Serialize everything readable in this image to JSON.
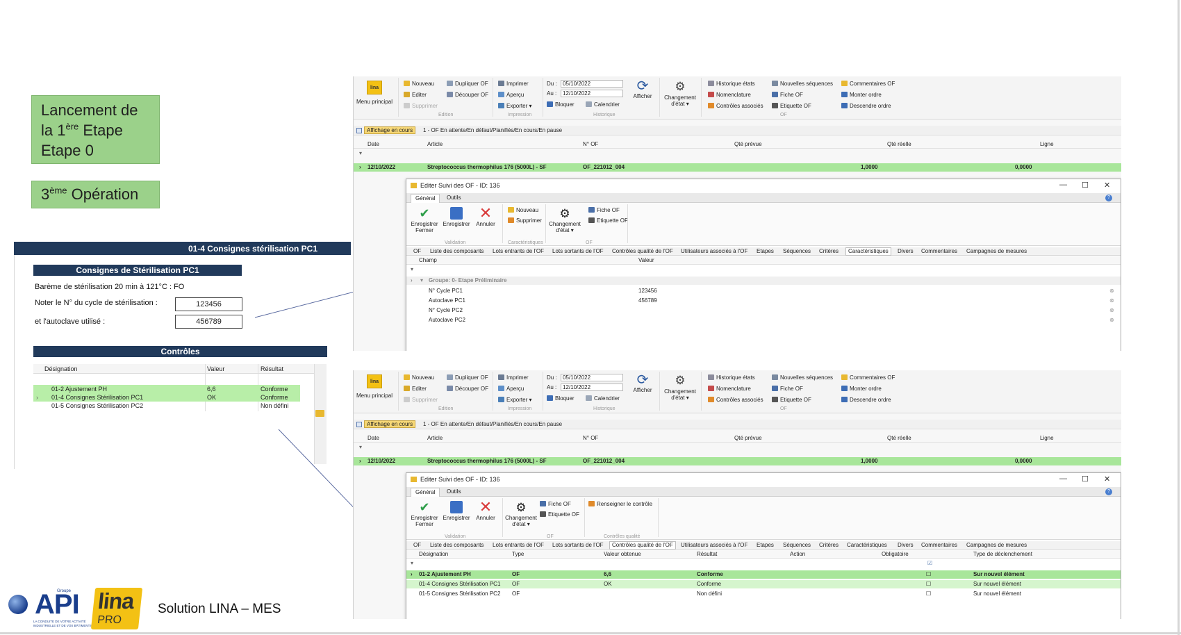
{
  "slide": {
    "title_box": {
      "line1": "Lancement de",
      "line2_pre": "la 1",
      "line2_sup": "ère",
      "line2_post": " Etape",
      "line3": "Etape 0"
    },
    "op_box": {
      "pre": "3",
      "sup": "ème",
      "post": " Opération"
    },
    "footer": "Solution LINA – MES",
    "logo_api": "API",
    "logo_api_small": "Groupe",
    "logo_api_tagline1": "LA CONDUITE DE VOTRE ACTIVITÉ",
    "logo_api_tagline2": "INDUSTRIELLE ET DE VOS BÂTIMENTS",
    "logo_lina": "lina",
    "logo_pro": "PRO"
  },
  "form": {
    "panel_title": "01-4 Consignes stérilisation PC1",
    "section_title": "Consignes de Stérilisation PC1",
    "bareme": "Barème de stérilisation 20 min à 121°C : FO",
    "cycle_label": "Noter le N° du cycle de stérilisation :",
    "cycle_value": "123456",
    "autoclave_label": "et l'autoclave utilisé :",
    "autoclave_value": "456789",
    "controls_title": "Contrôles",
    "table_headers": [
      "Désignation",
      "Valeur",
      "Résultat"
    ],
    "rows": [
      {
        "designation": "01-2 Ajustement PH",
        "valeur": "6,6",
        "resultat": "Conforme"
      },
      {
        "designation": "01-4 Consignes Stérilisation PC1",
        "valeur": "OK",
        "resultat": "Conforme"
      },
      {
        "designation": "01-5 Consignes Stérilisation PC2",
        "valeur": "",
        "resultat": "Non défini"
      }
    ]
  },
  "ribbon": {
    "menu_principal": "Menu principal",
    "nouveau": "Nouveau",
    "editer": "Editer",
    "supprimer": "Supprimer",
    "dupliquer": "Dupliquer OF",
    "decouper": "Découper OF",
    "imprimer": "Imprimer",
    "apercu": "Aperçu",
    "exporter": "Exporter",
    "du_label": "Du :",
    "du_value": "05/10/2022",
    "au_label": "Au :",
    "au_value": "12/10/2022",
    "bloquer": "Bloquer",
    "calendrier": "Calendrier",
    "afficher": "Afficher",
    "changement": "Changement",
    "detat": "d'état",
    "historique_etats": "Historique états",
    "nomenclature": "Nomenclature",
    "controles_associes": "Contrôles associés",
    "nouvelles_sequences": "Nouvelles séquences",
    "fiche_of": "Fiche OF",
    "etiquette_of": "Etiquette OF",
    "commentaires_of": "Commentaires OF",
    "monter_ordre": "Monter ordre",
    "descendre_ordre": "Descendre ordre",
    "groups": [
      "Edition",
      "Impression",
      "Historique",
      "OF"
    ]
  },
  "filter": {
    "tag": "Affichage en cours",
    "text": "1 - OF En attente/En défaut/Planifiés/En cours/En pause"
  },
  "grid": {
    "headers": [
      "Date",
      "Article",
      "N° OF",
      "Qté prévue",
      "Qté réelle",
      "Ligne"
    ],
    "row": {
      "date": "12/10/2022",
      "article": "Streptococcus thermophilus 176 (5000L) - SF",
      "of": "OF_221012_004",
      "qte_prevue": "1,0000",
      "qte_reelle": "0,0000"
    }
  },
  "dialog": {
    "title": "Editer Suivi des OF - ID: 136",
    "tabs": [
      "Général",
      "Outils"
    ],
    "enregistrer_fermer_1": "Enregistrer",
    "enregistrer_fermer_2": "Fermer",
    "enregistrer": "Enregistrer",
    "annuler": "Annuler",
    "nouveau": "Nouveau",
    "supprimer": "Supprimer",
    "changement": "Changement",
    "detat": "d'état",
    "fiche_of": "Fiche OF",
    "etiquette_of": "Etiquette OF",
    "renseigner": "Renseigner le contrôle",
    "groups_top": [
      "Validation",
      "Caractéristiques",
      "OF"
    ],
    "groups_bottom": [
      "Validation",
      "OF",
      "Contrôles qualité"
    ],
    "subtabs": [
      "OF",
      "Liste des composants",
      "Lots entrants de l'OF",
      "Lots sortants de l'OF",
      "Contrôles qualité de l'OF",
      "Utilisateurs associés à l'OF",
      "Etapes",
      "Séquences",
      "Critères",
      "Caractéristiques",
      "Divers",
      "Commentaires",
      "Campagnes de mesures"
    ]
  },
  "carac": {
    "headers": [
      "Champ",
      "Valeur"
    ],
    "group": "Groupe: 0- Etape Préliminaire",
    "rows": [
      {
        "champ": "N° Cycle PC1",
        "valeur": "123456"
      },
      {
        "champ": "Autoclave PC1",
        "valeur": "456789"
      },
      {
        "champ": "N° Cycle PC2",
        "valeur": ""
      },
      {
        "champ": "Autoclave PC2",
        "valeur": ""
      }
    ]
  },
  "qc": {
    "headers": [
      "Désignation",
      "Type",
      "Valeur obtenue",
      "Résultat",
      "Action",
      "Obligatoire",
      "Type de déclenchement"
    ],
    "rows": [
      {
        "designation": "01-2 Ajustement PH",
        "type": "OF",
        "valeur": "6,6",
        "resultat": "Conforme",
        "declenchement": "Sur nouvel élément"
      },
      {
        "designation": "01-4 Consignes Stérilisation PC1",
        "type": "OF",
        "valeur": "OK",
        "resultat": "Conforme",
        "declenchement": "Sur nouvel élément"
      },
      {
        "designation": "01-5 Consignes Stérilisation PC2",
        "type": "OF",
        "valeur": "",
        "resultat": "Non défini",
        "declenchement": "Sur nouvel élément"
      }
    ]
  },
  "colors": {
    "green_box": "#9bd18a",
    "navy": "#213a5b",
    "row_green": "#a8e69a",
    "filter_tag": "#f6d776",
    "lina_yellow": "#f3c114",
    "api_blue": "#1a3e8c"
  }
}
